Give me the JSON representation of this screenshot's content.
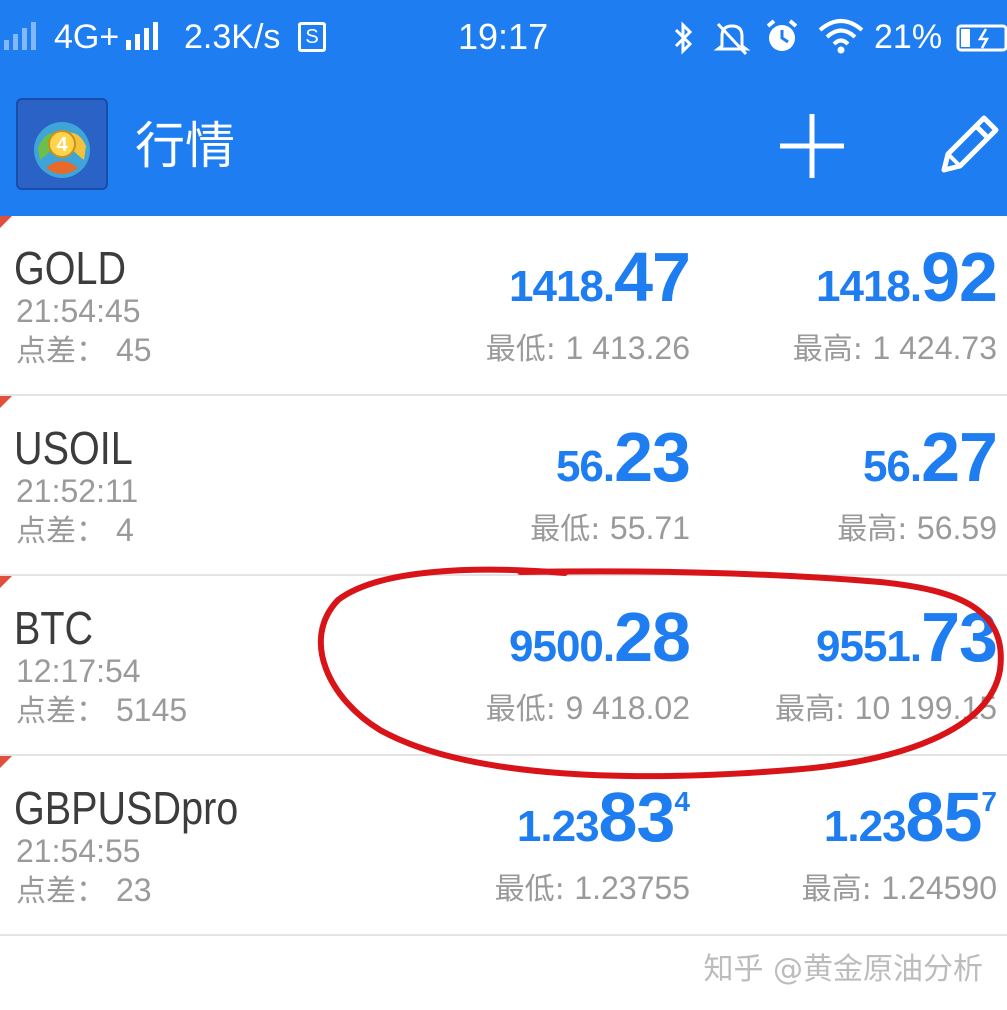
{
  "status_bar": {
    "network": "4G+",
    "speed": "2.3K/s",
    "sim_icon": "S",
    "time": "19:17",
    "battery": "21%",
    "icons": [
      "signal-icon",
      "sim-icon",
      "bluetooth-icon",
      "mute-icon",
      "alarm-icon",
      "wifi-icon",
      "battery-icon"
    ]
  },
  "app_bar": {
    "title": "行情",
    "logo": "metatrader-4-logo",
    "actions": [
      "add-icon",
      "edit-pencil-icon"
    ]
  },
  "quotes": [
    {
      "symbol": "GOLD",
      "time": "21:54:45",
      "spread_label": "点差：",
      "spread": "45",
      "bid_main": "1418.",
      "bid_big": "47",
      "bid_pip": "",
      "ask_main": "1418.",
      "ask_big": "92",
      "ask_pip": "",
      "low_label": "最低:",
      "low": "1 413.26",
      "high_label": "最高:",
      "high": "1 424.73"
    },
    {
      "symbol": "USOIL",
      "time": "21:52:11",
      "spread_label": "点差：",
      "spread": "4",
      "bid_main": "56.",
      "bid_big": "23",
      "bid_pip": "",
      "ask_main": "56.",
      "ask_big": "27",
      "ask_pip": "",
      "low_label": "最低:",
      "low": "55.71",
      "high_label": "最高:",
      "high": "56.59"
    },
    {
      "symbol": "BTC",
      "time": "12:17:54",
      "spread_label": "点差：",
      "spread": "5145",
      "bid_main": "9500.",
      "bid_big": "28",
      "bid_pip": "",
      "ask_main": "9551.",
      "ask_big": "73",
      "ask_pip": "",
      "low_label": "最低:",
      "low": "9 418.02",
      "high_label": "最高:",
      "high": "10 199.15"
    },
    {
      "symbol": "GBPUSDpro",
      "time": "21:54:55",
      "spread_label": "点差：",
      "spread": "23",
      "bid_main": "1.23",
      "bid_big": "83",
      "bid_pip": "4",
      "ask_main": "1.23",
      "ask_big": "85",
      "ask_pip": "7",
      "low_label": "最低:",
      "low": "1.23755",
      "high_label": "最高:",
      "high": "1.24590"
    }
  ],
  "annotation": {
    "color": "#d81418",
    "shape": "hand-drawn-circle"
  },
  "watermark": "知乎 @黄金原油分析",
  "colors": {
    "accent": "#1e7df0",
    "price": "#1e7df0",
    "muted": "#9a9a9a",
    "corner": "#e0503c"
  }
}
